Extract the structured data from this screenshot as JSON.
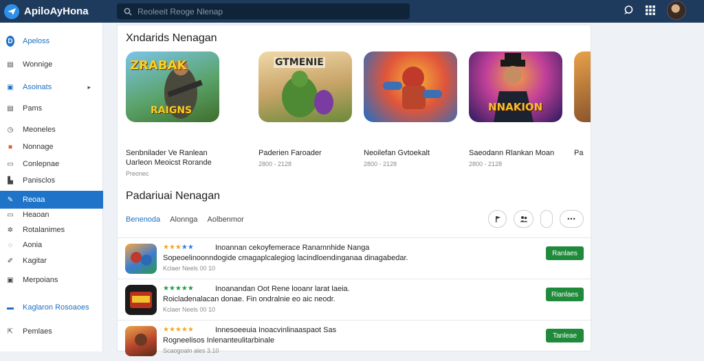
{
  "app": {
    "title": "ApiloAyHona"
  },
  "search": {
    "placeholder": "Reoleeit Reoge Nlenap"
  },
  "sidebar": {
    "items": [
      {
        "label": "Apeloss",
        "icon": "app-logo-icon"
      },
      {
        "label": "Wonnige",
        "icon": "list-icon"
      },
      {
        "label": "Asoinats",
        "icon": "apps-icon"
      },
      {
        "label": "Pams",
        "icon": "doc-icon"
      },
      {
        "label": "Meoneles",
        "icon": "clock-icon"
      },
      {
        "label": "Nonnage",
        "icon": "tag-icon"
      },
      {
        "label": "Conlepnae",
        "icon": "box-icon"
      },
      {
        "label": "Panisclos",
        "icon": "person-icon"
      },
      {
        "label": "Reoaa",
        "icon": "edit-icon"
      },
      {
        "label": "Heaoan",
        "icon": "card-icon"
      },
      {
        "label": "Rotalanimes",
        "icon": "settings-icon"
      },
      {
        "label": "Aonia",
        "icon": "chat-icon"
      },
      {
        "label": "Kagitar",
        "icon": "pen-icon"
      },
      {
        "label": "Merpoians",
        "icon": "folder-icon"
      },
      {
        "label": "Kaglaron Rosoaoes",
        "icon": "inbox-icon"
      },
      {
        "label": "Pemlaes",
        "icon": "share-icon"
      }
    ]
  },
  "featured": {
    "title": "Xndarids Nenagan",
    "cards": [
      {
        "name": "Senbnilader Ve Ranlean Uarleon Meoicst Rorande",
        "meta": "Preonec",
        "art": "ZRABAK",
        "art2": "RAIGNS"
      },
      {
        "name": "Paderien Faroader",
        "meta": "2800 - 2128",
        "art": "GTMENIE"
      },
      {
        "name": "Neoilefan Gvtoekalt",
        "meta": "2800 - 2128",
        "art": ""
      },
      {
        "name": "Saeodann Rlankan Moan",
        "meta": "2800 - 2128",
        "art": "NNAKION"
      },
      {
        "name": "Pa",
        "meta": ""
      }
    ]
  },
  "list": {
    "title": "Padariuai Nenagan",
    "tabs": [
      "Benenoda",
      "Alonnga",
      "Aolbenmor"
    ],
    "filter_more": "•••",
    "rows": [
      {
        "stars": "★★★★★",
        "title": "Inoannan cekoyfemerace Ranamnhide Nanga",
        "desc": "Sopeoelinoonndogide cmagaplcalegiog lacindloendinganaa dinagabedar.",
        "meta": "Kclaer Neels 00 10",
        "button": "Ranlaes"
      },
      {
        "stars": "★★★★★",
        "title": "Inoanandan Oot Rene looanr larat laeia.",
        "desc": "Roicladenalacan donae. Fin ondralnie eo aic neodr.",
        "meta": "Kclaer Neels 00 10",
        "button": "Rianlaes"
      },
      {
        "stars": "★★★★★",
        "title": "Innesoeeuia Inoacvinlinaaspaot Sas",
        "desc": "Rogneelisos Inlenanteulitarbinale",
        "meta": "Scaogoaln ales 3.10",
        "button": "Tanleae"
      }
    ]
  },
  "colors": {
    "topbar": "#1e3a5c",
    "accent": "#1f73c8",
    "install": "#1f8a3a"
  }
}
